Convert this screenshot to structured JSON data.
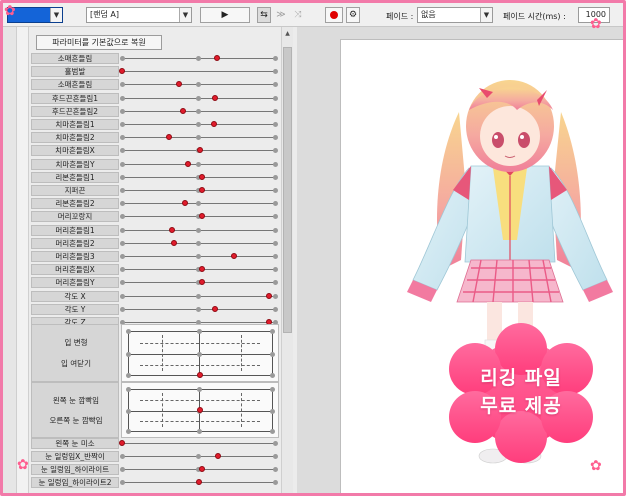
{
  "toolbar": {
    "motion_select": "[랜덤 A]",
    "fade_label": "페이드 :",
    "fade_value": "없음",
    "fade_time_label": "페이드 시간(ms) :",
    "fade_time_value": "1000"
  },
  "params": {
    "reset_label": "파라미터를 기본값으로 복원",
    "sliders": [
      {
        "label": "소매흔들림",
        "value": 0.62,
        "ticks": [
          0,
          0.5,
          1
        ]
      },
      {
        "label": "홀범발",
        "value": 0.0,
        "ticks": [
          1
        ]
      },
      {
        "label": "소매흔들림",
        "value": 0.37,
        "ticks": [
          0,
          0.5,
          1
        ]
      },
      {
        "label": "후드끈흔들림1",
        "value": 0.61,
        "ticks": [
          0,
          0.5,
          1
        ]
      },
      {
        "label": "후드끈흔들림2",
        "value": 0.4,
        "ticks": [
          0,
          0.5,
          1
        ]
      },
      {
        "label": "치마흔들림1",
        "value": 0.6,
        "ticks": [
          0,
          0.5,
          1
        ]
      },
      {
        "label": "치마흔들림2",
        "value": 0.31,
        "ticks": [
          0,
          0.5,
          1
        ]
      },
      {
        "label": "치마흔들림X",
        "value": 0.51,
        "ticks": [
          0,
          0.5,
          1
        ]
      },
      {
        "label": "치마흔들림Y",
        "value": 0.43,
        "ticks": [
          0,
          0.5,
          1
        ]
      },
      {
        "label": "리본흔들림1",
        "value": 0.52,
        "ticks": [
          0,
          0.5,
          1
        ]
      },
      {
        "label": "지퍼끈",
        "value": 0.52,
        "ticks": [
          0,
          0.5,
          1
        ]
      },
      {
        "label": "리본흔들림2",
        "value": 0.41,
        "ticks": [
          0,
          0.5,
          1
        ]
      },
      {
        "label": "머리꼬랑지",
        "value": 0.52,
        "ticks": [
          0,
          0.5,
          1
        ]
      },
      {
        "label": "머리흔들림1",
        "value": 0.33,
        "ticks": [
          0,
          0.5,
          1
        ]
      },
      {
        "label": "머리흔들림2",
        "value": 0.34,
        "ticks": [
          0,
          0.5,
          1
        ]
      },
      {
        "label": "머리흔들림3",
        "value": 0.73,
        "ticks": [
          0,
          0.5,
          1
        ]
      },
      {
        "label": "머리흔들림X",
        "value": 0.52,
        "ticks": [
          0,
          0.5,
          1
        ]
      },
      {
        "label": "머리흔들림Y",
        "value": 0.52,
        "ticks": [
          0,
          0.5,
          1
        ]
      },
      {
        "label": "각도 X",
        "value": 0.96,
        "ticks": [
          0,
          0.5,
          1
        ]
      },
      {
        "label": "각도 Y",
        "value": 0.61,
        "ticks": [
          0,
          0.5,
          1
        ]
      },
      {
        "label": "각도 Z",
        "value": 0.96,
        "ticks": [
          0,
          0.5,
          1
        ]
      }
    ],
    "mouth_block": {
      "label1": "입 변형",
      "label2": "입 여닫기",
      "knob_x": 0.5,
      "knob_y": 1.0
    },
    "eye_block": {
      "label1": "왼쪽 눈 깜빡임",
      "label2": "오른쪽 눈 깜빡임",
      "knob_x": 0.5,
      "knob_y": 0.5
    },
    "bottom_sliders": [
      {
        "label": "왼쪽 눈 미소",
        "value": 0.0,
        "ticks": [
          1
        ]
      },
      {
        "label": "눈 일렁임X_반짝이",
        "value": 0.63,
        "ticks": [
          0,
          0.5,
          1
        ]
      },
      {
        "label": "눈 일렁임_하이라이트",
        "value": 0.52,
        "ticks": [
          0,
          0.5,
          1
        ]
      },
      {
        "label": "눈 일렁임_하이라이트2",
        "value": 0.5,
        "ticks": [
          0,
          0.5,
          1
        ]
      }
    ]
  },
  "badge": {
    "line1": "리깅 파일",
    "line2": "무료 제공",
    "color_top": "#ff6b9e",
    "color_bottom": "#ff3d7c"
  },
  "colors": {
    "frame": "#f27aa9",
    "knob": "#e01c2c",
    "accent_blue": "#1464d8"
  }
}
